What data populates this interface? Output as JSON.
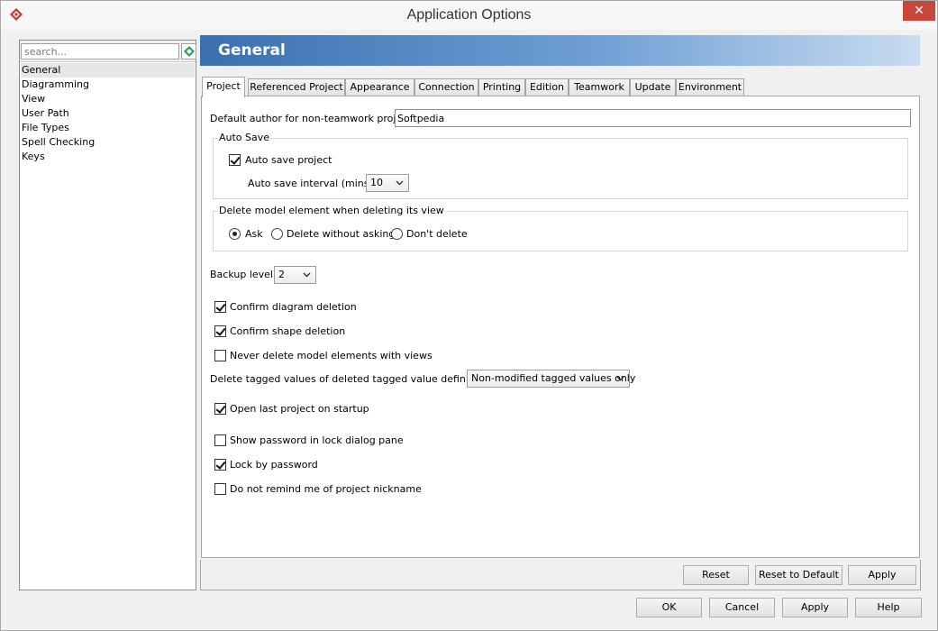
{
  "window": {
    "title": "Application Options"
  },
  "sidebar": {
    "search_placeholder": "search...",
    "items": [
      {
        "label": "General",
        "selected": true
      },
      {
        "label": "Diagramming"
      },
      {
        "label": "View"
      },
      {
        "label": "User Path"
      },
      {
        "label": "File Types"
      },
      {
        "label": "Spell Checking"
      },
      {
        "label": "Keys"
      }
    ]
  },
  "header": {
    "title": "General"
  },
  "tabs": [
    {
      "label": "Project",
      "active": true
    },
    {
      "label": "Referenced Project"
    },
    {
      "label": "Appearance"
    },
    {
      "label": "Connection"
    },
    {
      "label": "Printing"
    },
    {
      "label": "Edition"
    },
    {
      "label": "Teamwork"
    },
    {
      "label": "Update"
    },
    {
      "label": "Environment"
    }
  ],
  "project": {
    "default_author_label": "Default author for non-teamwork project:",
    "default_author_value": "Softpedia",
    "auto_save": {
      "title": "Auto Save",
      "auto_save_project_label": "Auto save project",
      "auto_save_project_checked": true,
      "interval_label": "Auto save interval (mins) :",
      "interval_value": "10"
    },
    "delete_model": {
      "title": "Delete model element when deleting its view",
      "options": [
        {
          "label": "Ask",
          "checked": true
        },
        {
          "label": "Delete without asking",
          "checked": false
        },
        {
          "label": "Don't delete",
          "checked": false
        }
      ]
    },
    "backup_level_label": "Backup level :",
    "backup_level_value": "2",
    "confirm_diagram_deletion_label": "Confirm diagram deletion",
    "confirm_diagram_deletion_checked": true,
    "confirm_shape_deletion_label": "Confirm shape deletion",
    "confirm_shape_deletion_checked": true,
    "never_delete_label": "Never delete model elements with views",
    "never_delete_checked": false,
    "delete_tagged_label": "Delete tagged values of deleted tagged value definitions :",
    "delete_tagged_value": "Non-modified tagged values only",
    "open_last_label": "Open last project on startup",
    "open_last_checked": true,
    "show_password_label": "Show password in lock dialog pane",
    "show_password_checked": false,
    "lock_by_password_label": "Lock by password",
    "lock_by_password_checked": true,
    "do_not_remind_label": "Do not remind me of project nickname",
    "do_not_remind_checked": false
  },
  "panel_buttons": {
    "reset": "Reset",
    "reset_default": "Reset to Default",
    "apply": "Apply"
  },
  "dialog_buttons": {
    "ok": "OK",
    "cancel": "Cancel",
    "apply": "Apply",
    "help": "Help"
  },
  "colors": {
    "header_start": "#3c6fb0",
    "header_end": "#c9dcf0",
    "close": "#c7483a"
  }
}
